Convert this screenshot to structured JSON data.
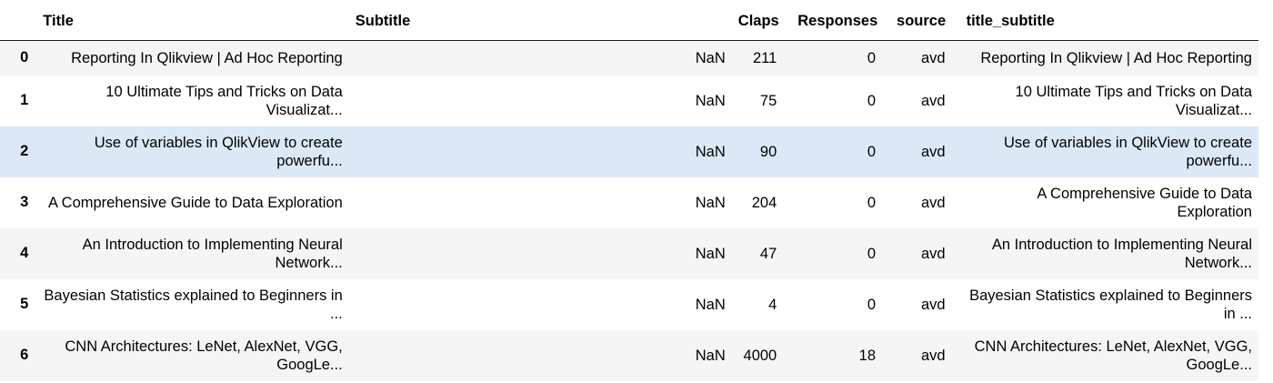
{
  "columns": {
    "index": "",
    "title": "Title",
    "subtitle": "Subtitle",
    "claps": "Claps",
    "responses": "Responses",
    "source": "source",
    "title_subtitle": "title_subtitle"
  },
  "rows": [
    {
      "index": "0",
      "title": "Reporting In Qlikview | Ad Hoc Reporting",
      "subtitle": "NaN",
      "claps": "211",
      "responses": "0",
      "source": "avd",
      "title_subtitle": "Reporting In Qlikview | Ad Hoc Reporting"
    },
    {
      "index": "1",
      "title": "10 Ultimate Tips and Tricks on Data Visualizat...",
      "subtitle": "NaN",
      "claps": "75",
      "responses": "0",
      "source": "avd",
      "title_subtitle": "10 Ultimate Tips and Tricks on Data Visualizat..."
    },
    {
      "index": "2",
      "title": "Use of variables in QlikView to create powerfu...",
      "subtitle": "NaN",
      "claps": "90",
      "responses": "0",
      "source": "avd",
      "title_subtitle": "Use of variables in QlikView to create powerfu..."
    },
    {
      "index": "3",
      "title": "A Comprehensive Guide to Data Exploration",
      "subtitle": "NaN",
      "claps": "204",
      "responses": "0",
      "source": "avd",
      "title_subtitle": "A Comprehensive Guide to Data Exploration"
    },
    {
      "index": "4",
      "title": "An Introduction to Implementing Neural Network...",
      "subtitle": "NaN",
      "claps": "47",
      "responses": "0",
      "source": "avd",
      "title_subtitle": "An Introduction to Implementing Neural Network..."
    },
    {
      "index": "5",
      "title": "Bayesian Statistics explained to Beginners in ...",
      "subtitle": "NaN",
      "claps": "4",
      "responses": "0",
      "source": "avd",
      "title_subtitle": "Bayesian Statistics explained to Beginners in ..."
    },
    {
      "index": "6",
      "title": "CNN Architectures: LeNet, AlexNet, VGG, GoogLe...",
      "subtitle": "NaN",
      "claps": "4000",
      "responses": "18",
      "source": "avd",
      "title_subtitle": "CNN Architectures: LeNet, AlexNet, VGG, GoogLe..."
    }
  ],
  "highlighted_row": 2,
  "colors": {
    "row_stripe": "#f5f5f5",
    "row_hover": "#dbe9f7",
    "header_rule": "#1a1a1a"
  }
}
